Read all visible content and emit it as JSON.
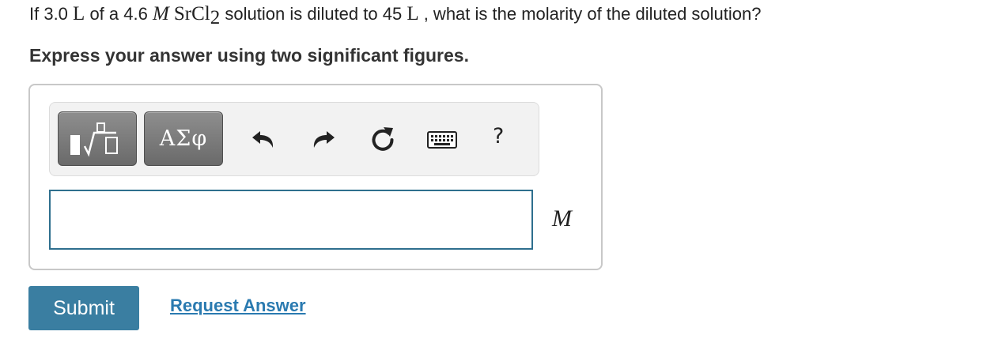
{
  "question": {
    "p1": "If 3.0 ",
    "unit_l": "L",
    "p2": " of a 4.6 ",
    "unit_m": "M",
    "formula_main": "SrCl",
    "formula_sub": "2",
    "p3": " solution is diluted to 45 ",
    "unit_l2": "L",
    "p4": " , what is the molarity of the diluted solution?"
  },
  "instruction": "Express your answer using two significant figures.",
  "toolbar": {
    "templates_icon": "templates-icon",
    "symbols_label": "ΑΣφ",
    "undo_icon": "undo-icon",
    "redo_icon": "redo-icon",
    "reset_icon": "reset-icon",
    "keyboard_icon": "keyboard-icon",
    "help_label": "?"
  },
  "answer": {
    "value": "",
    "unit": "M"
  },
  "buttons": {
    "submit": "Submit",
    "request_answer": "Request Answer"
  },
  "colors": {
    "submit_bg": "#3a7ea1",
    "link": "#2a7ab0",
    "input_border": "#2e6f8e"
  }
}
